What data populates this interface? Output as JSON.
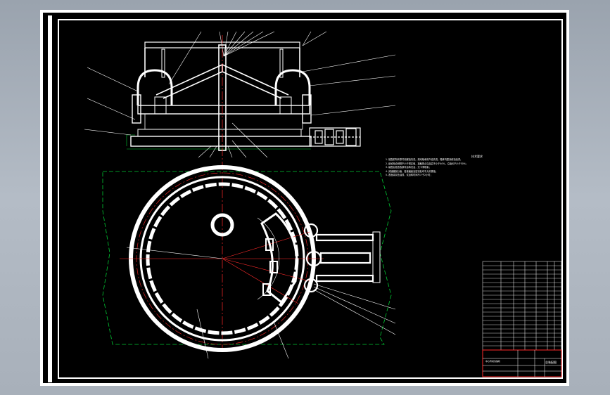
{
  "sheet": {
    "background": "#000000",
    "frame_color": "#ffffff",
    "centerline_color": "#ff2a2a",
    "hidden_line_color": "#00cc33",
    "dimension_color": "#ffffff"
  },
  "technical_notes": {
    "title": "技术要求",
    "lines": [
      "1. 装配前所有零件用煤油清洗，滚动轴承用汽油清洗，箱体内壁涂耐油油漆；",
      "2. 齿轮啮合侧隙不小于规定值，接触斑点沿齿高不小于40%，沿齿长不小于50%；",
      "3. 装配后检查各部件运转灵活，无卡滞现象；",
      "4. 减速器剖分面、各接触面及密封处均不允许漏油；",
      "5. 表面涂灰色油漆，试运转时间不少于2小时；"
    ]
  },
  "title_block": {
    "drawing_name": "中心传动浓缩机",
    "drawing_number": "总装配图"
  },
  "icons": [
    "dimension-leader-icon",
    "centerline-icon"
  ]
}
